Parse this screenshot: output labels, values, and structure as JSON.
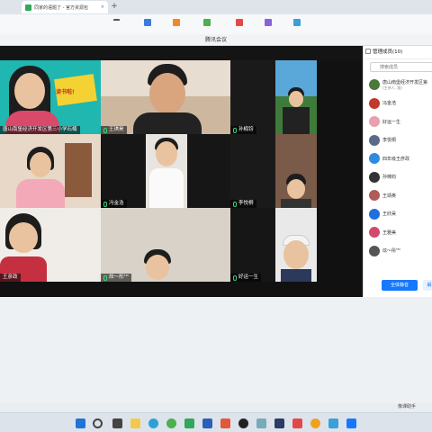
{
  "browser": {
    "tab_title": "同家的语题了 - 官方资源包",
    "tab_close": "×",
    "new_tab": "+"
  },
  "window": {
    "title": "腾讯会议"
  },
  "tiles": [
    {
      "name": "唐山南堡经济开发区第三小学石楠",
      "banner": "读书啦!"
    },
    {
      "name": "王琪昊"
    },
    {
      "name": "孙楠钧"
    },
    {
      "name": ""
    },
    {
      "name": "冯金浩"
    },
    {
      "name": "李悦桐"
    },
    {
      "name": "王彦政"
    },
    {
      "name": "炫～彤ᵀᴹ"
    },
    {
      "name": "好运一生"
    }
  ],
  "panel": {
    "title": "管理成员(10)",
    "search_placeholder": "搜索成员",
    "members": [
      {
        "name": "唐山南堡经济开发区第",
        "sub": "(主持人, 我)",
        "color": "#4a7a3a"
      },
      {
        "name": "冯金浩",
        "color": "#c0392b"
      },
      {
        "name": "好运一生",
        "color": "#e8a0b0"
      },
      {
        "name": "李悦桐",
        "color": "#5a6a8a"
      },
      {
        "name": "四年级王彦政",
        "color": "#2d8ce0"
      },
      {
        "name": "孙楠钧",
        "color": "#333333"
      },
      {
        "name": "王靖奥",
        "color": "#b05a5a"
      },
      {
        "name": "王欣昊",
        "color": "#1f6fe0"
      },
      {
        "name": "王雅美",
        "color": "#d14a6a"
      },
      {
        "name": "炫～彤ᵀᴹ",
        "color": "#555555"
      }
    ],
    "mute_all": "全体静音",
    "unmute_all": "解"
  },
  "status": {
    "text": "像课助手"
  }
}
